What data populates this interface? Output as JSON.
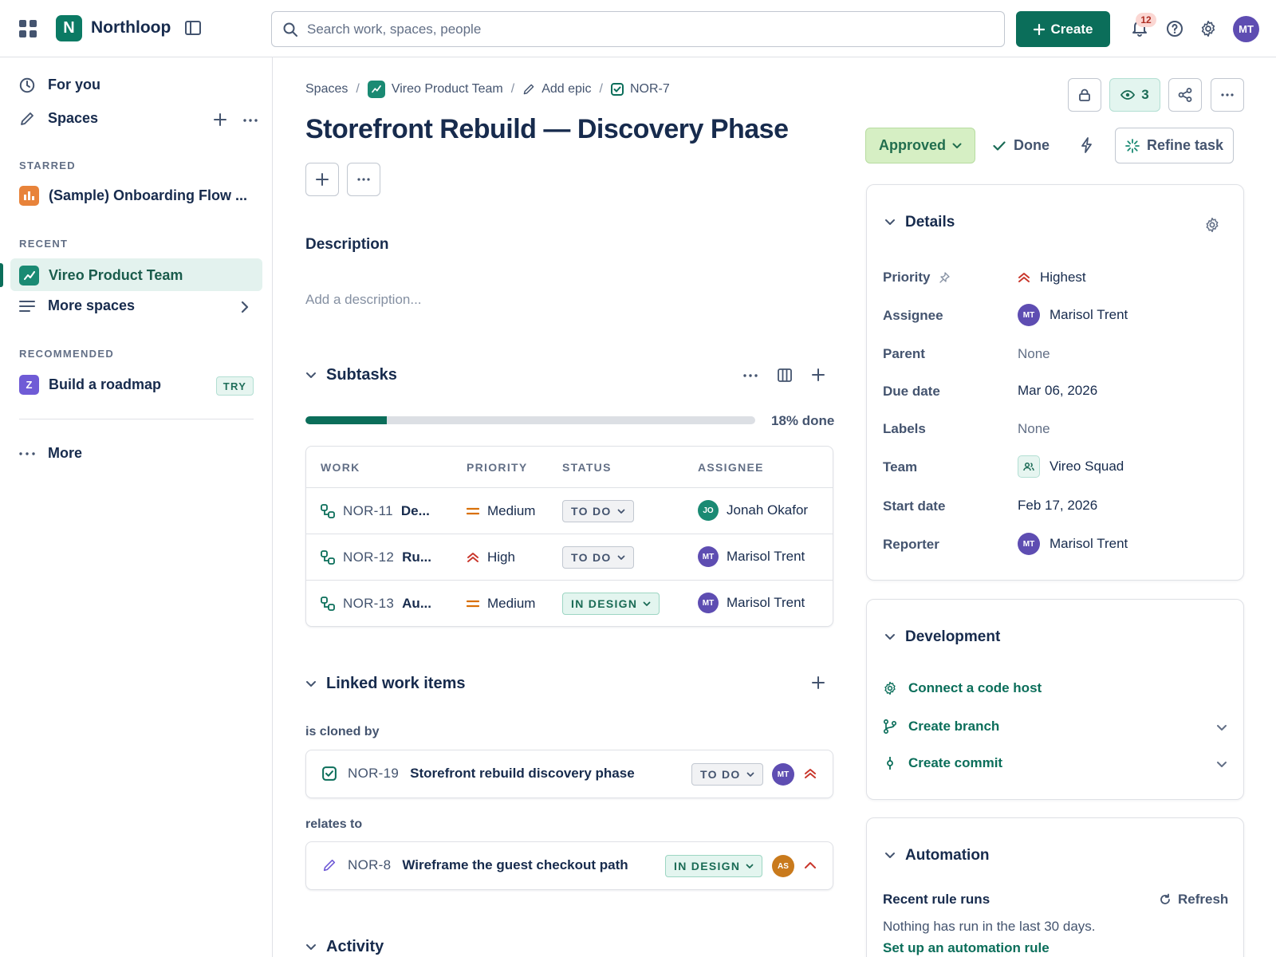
{
  "app": {
    "brand": "Northloop",
    "logo_letter": "N",
    "search_placeholder": "Search work, spaces, people",
    "create_label": "Create",
    "notifications_count": "12",
    "user_initials": "MT"
  },
  "sidebar": {
    "for_you": "For you",
    "spaces": "Spaces",
    "starred_heading": "STARRED",
    "starred_item": "(Sample) Onboarding Flow ...",
    "recent_heading": "RECENT",
    "recent_item": "Vireo Product Team",
    "more_spaces": "More spaces",
    "recommended_heading": "RECOMMENDED",
    "recommended_item": "Build a roadmap",
    "recommended_icon_letter": "Z",
    "try_badge": "TRY",
    "more": "More"
  },
  "breadcrumb": {
    "spaces": "Spaces",
    "team": "Vireo Product Team",
    "add_epic": "Add epic",
    "key": "NOR-7"
  },
  "issue": {
    "title": "Storefront Rebuild — Discovery Phase",
    "description_heading": "Description",
    "description_placeholder": "Add a description..."
  },
  "subtasks": {
    "heading": "Subtasks",
    "progress_percent": 18,
    "progress_label": "18% done",
    "columns": [
      "WORK",
      "PRIORITY",
      "STATUS",
      "ASSIGNEE"
    ],
    "rows": [
      {
        "key": "NOR-11",
        "summary": "De...",
        "priority": "Medium",
        "status": "TO DO",
        "assignee_initials": "JO",
        "assignee": "Jonah Okafor"
      },
      {
        "key": "NOR-12",
        "summary": "Ru...",
        "priority": "High",
        "status": "TO DO",
        "assignee_initials": "MT",
        "assignee": "Marisol Trent"
      },
      {
        "key": "NOR-13",
        "summary": "Au...",
        "priority": "Medium",
        "status": "IN DESIGN",
        "assignee_initials": "MT",
        "assignee": "Marisol Trent"
      }
    ]
  },
  "linked": {
    "heading": "Linked work items",
    "groups": [
      {
        "relation": "is cloned by",
        "key": "NOR-19",
        "summary": "Storefront rebuild discovery phase",
        "status": "TO DO",
        "assignee_initials": "MT"
      },
      {
        "relation": "relates to",
        "key": "NOR-8",
        "summary": "Wireframe the guest checkout path",
        "status": "IN DESIGN",
        "assignee_initials": "AS"
      }
    ]
  },
  "activity": {
    "heading": "Activity"
  },
  "actions": {
    "watchers_count": "3",
    "status": "Approved",
    "done": "Done",
    "refine": "Refine task"
  },
  "details": {
    "heading": "Details",
    "fields": [
      {
        "label": "Priority",
        "value": "Highest"
      },
      {
        "label": "Assignee",
        "value": "Marisol Trent",
        "initials": "MT"
      },
      {
        "label": "Parent",
        "value": "None"
      },
      {
        "label": "Due date",
        "value": "Mar 06, 2026"
      },
      {
        "label": "Labels",
        "value": "None"
      },
      {
        "label": "Team",
        "value": "Vireo Squad"
      },
      {
        "label": "Start date",
        "value": "Feb 17, 2026"
      },
      {
        "label": "Reporter",
        "value": "Marisol Trent",
        "initials": "MT"
      }
    ]
  },
  "development": {
    "heading": "Development",
    "connect": "Connect a code host",
    "branch": "Create branch",
    "commit": "Create commit"
  },
  "automation": {
    "heading": "Automation",
    "recent_runs": "Recent rule runs",
    "refresh": "Refresh",
    "empty": "Nothing has run in the last 30 days.",
    "setup_link": "Set up an automation rule"
  },
  "colors": {
    "brand": "#0b6e5a",
    "approved_bg": "#d6efc4",
    "priority_high": "#c9372c",
    "priority_medium": "#d97008"
  }
}
